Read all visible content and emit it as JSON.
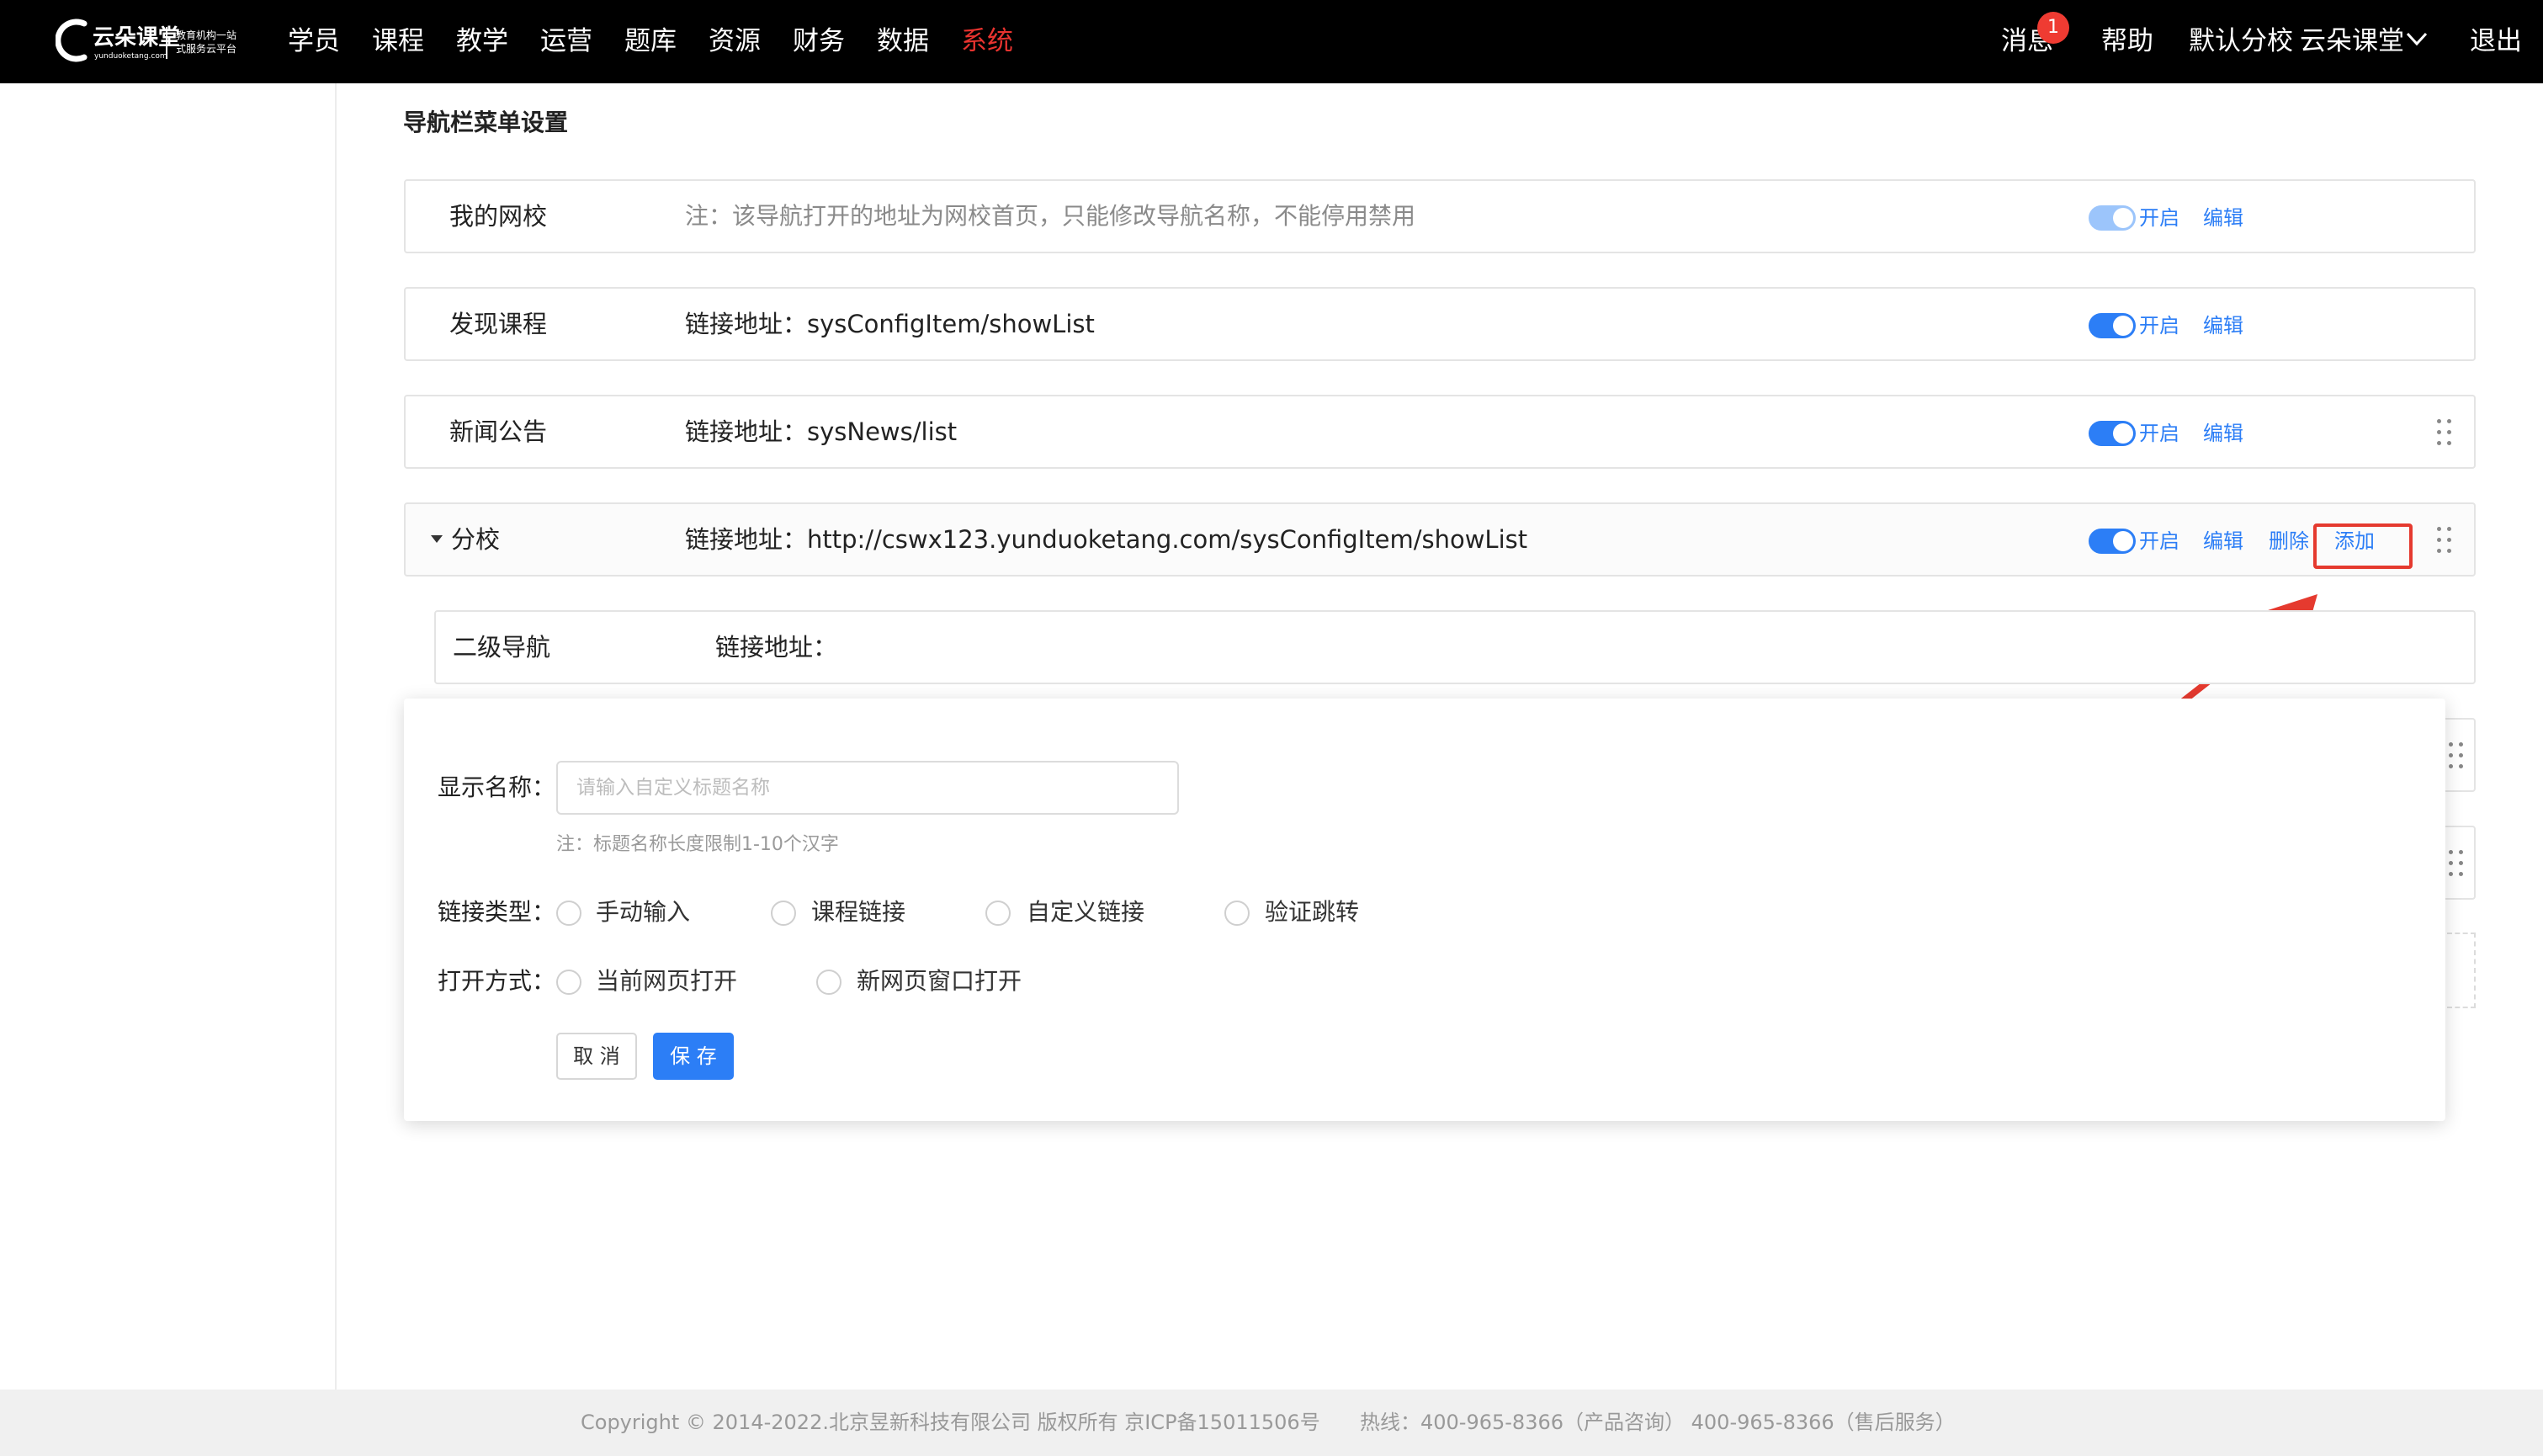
{
  "brand": {
    "logo_name": "云朵课堂",
    "logo_url": "yunduoketang.com",
    "slogan_line1": "教育机构一站",
    "slogan_line2": "式服务云平台"
  },
  "nav": {
    "items": [
      "学员",
      "课程",
      "教学",
      "运营",
      "题库",
      "资源",
      "财务",
      "数据",
      "系统"
    ],
    "active_index": 8,
    "right": {
      "messages": "消息",
      "message_count": "1",
      "help": "帮助",
      "school": "默认分校",
      "account": "云朵课堂",
      "logout": "退出"
    }
  },
  "page": {
    "section_title": "导航栏菜单设置"
  },
  "rows": [
    {
      "name": "我的网校",
      "note": "注：该导航打开的地址为网校首页，只能修改导航名称，不能停用禁用",
      "toggle_label": "开启",
      "edit": "编辑"
    },
    {
      "name": "发现课程",
      "url": "链接地址：sysConfigItem/showList",
      "toggle_label": "开启",
      "edit": "编辑"
    },
    {
      "name": "新闻公告",
      "url": "链接地址：sysNews/list",
      "toggle_label": "开启",
      "edit": "编辑"
    },
    {
      "name": "分校",
      "url": "链接地址：http://cswx123.yunduoketang.com/sysConfigItem/showList",
      "toggle_label": "开启",
      "edit": "编辑",
      "delete": "删除",
      "add": "添加"
    }
  ],
  "sub_row": {
    "name": "二级导航",
    "url": "链接地址："
  },
  "form": {
    "display_name_label": "显示名称：",
    "display_name_placeholder": "请输入自定义标题名称",
    "display_name_hint": "注：标题名称长度限制1-10个汉字",
    "link_type_label": "链接类型：",
    "link_type_options": [
      "手动输入",
      "课程链接",
      "自定义链接",
      "验证跳转"
    ],
    "open_mode_label": "打开方式：",
    "open_mode_options": [
      "当前网页打开",
      "新网页窗口打开"
    ],
    "cancel": "取 消",
    "save": "保 存"
  },
  "footer": {
    "copyright": "Copyright © 2014-2022.北京昱新科技有限公司 版权所有 京ICP备15011506号",
    "hotline": "热线：400-965-8366（产品咨询） 400-965-8366（售后服务）"
  },
  "colors": {
    "topbar": "#000000",
    "accent": "#2c7ef6",
    "active_nav": "#e8332f",
    "highlight": "#e53a2f"
  }
}
